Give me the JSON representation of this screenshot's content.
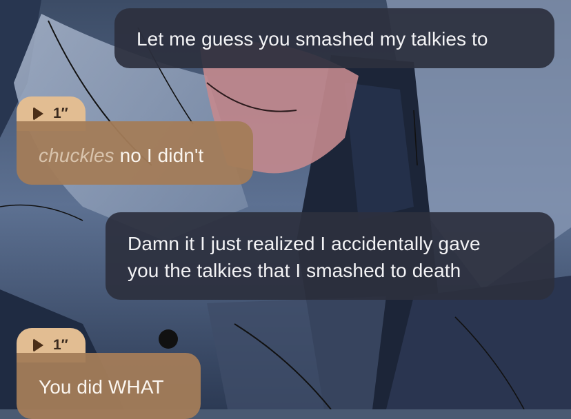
{
  "messages": [
    {
      "role": "user",
      "lines": [
        "Let me guess you smashed my talkies to"
      ]
    },
    {
      "role": "character",
      "voice_duration": "1″",
      "action": "chuckles",
      "text": " no I didn't"
    },
    {
      "role": "user",
      "lines": [
        "Damn it I just realized I accidentally gave",
        "you the talkies that I smashed to death"
      ]
    },
    {
      "role": "character",
      "voice_duration": "1″",
      "text": "You did WHAT"
    }
  ],
  "colors": {
    "user_bubble": "#2c303e",
    "character_bubble": "#a37c58",
    "voice_pill": "#e2bd92",
    "action_text": "#d9c4ad"
  },
  "icons": {
    "voice_play": "play-icon"
  }
}
